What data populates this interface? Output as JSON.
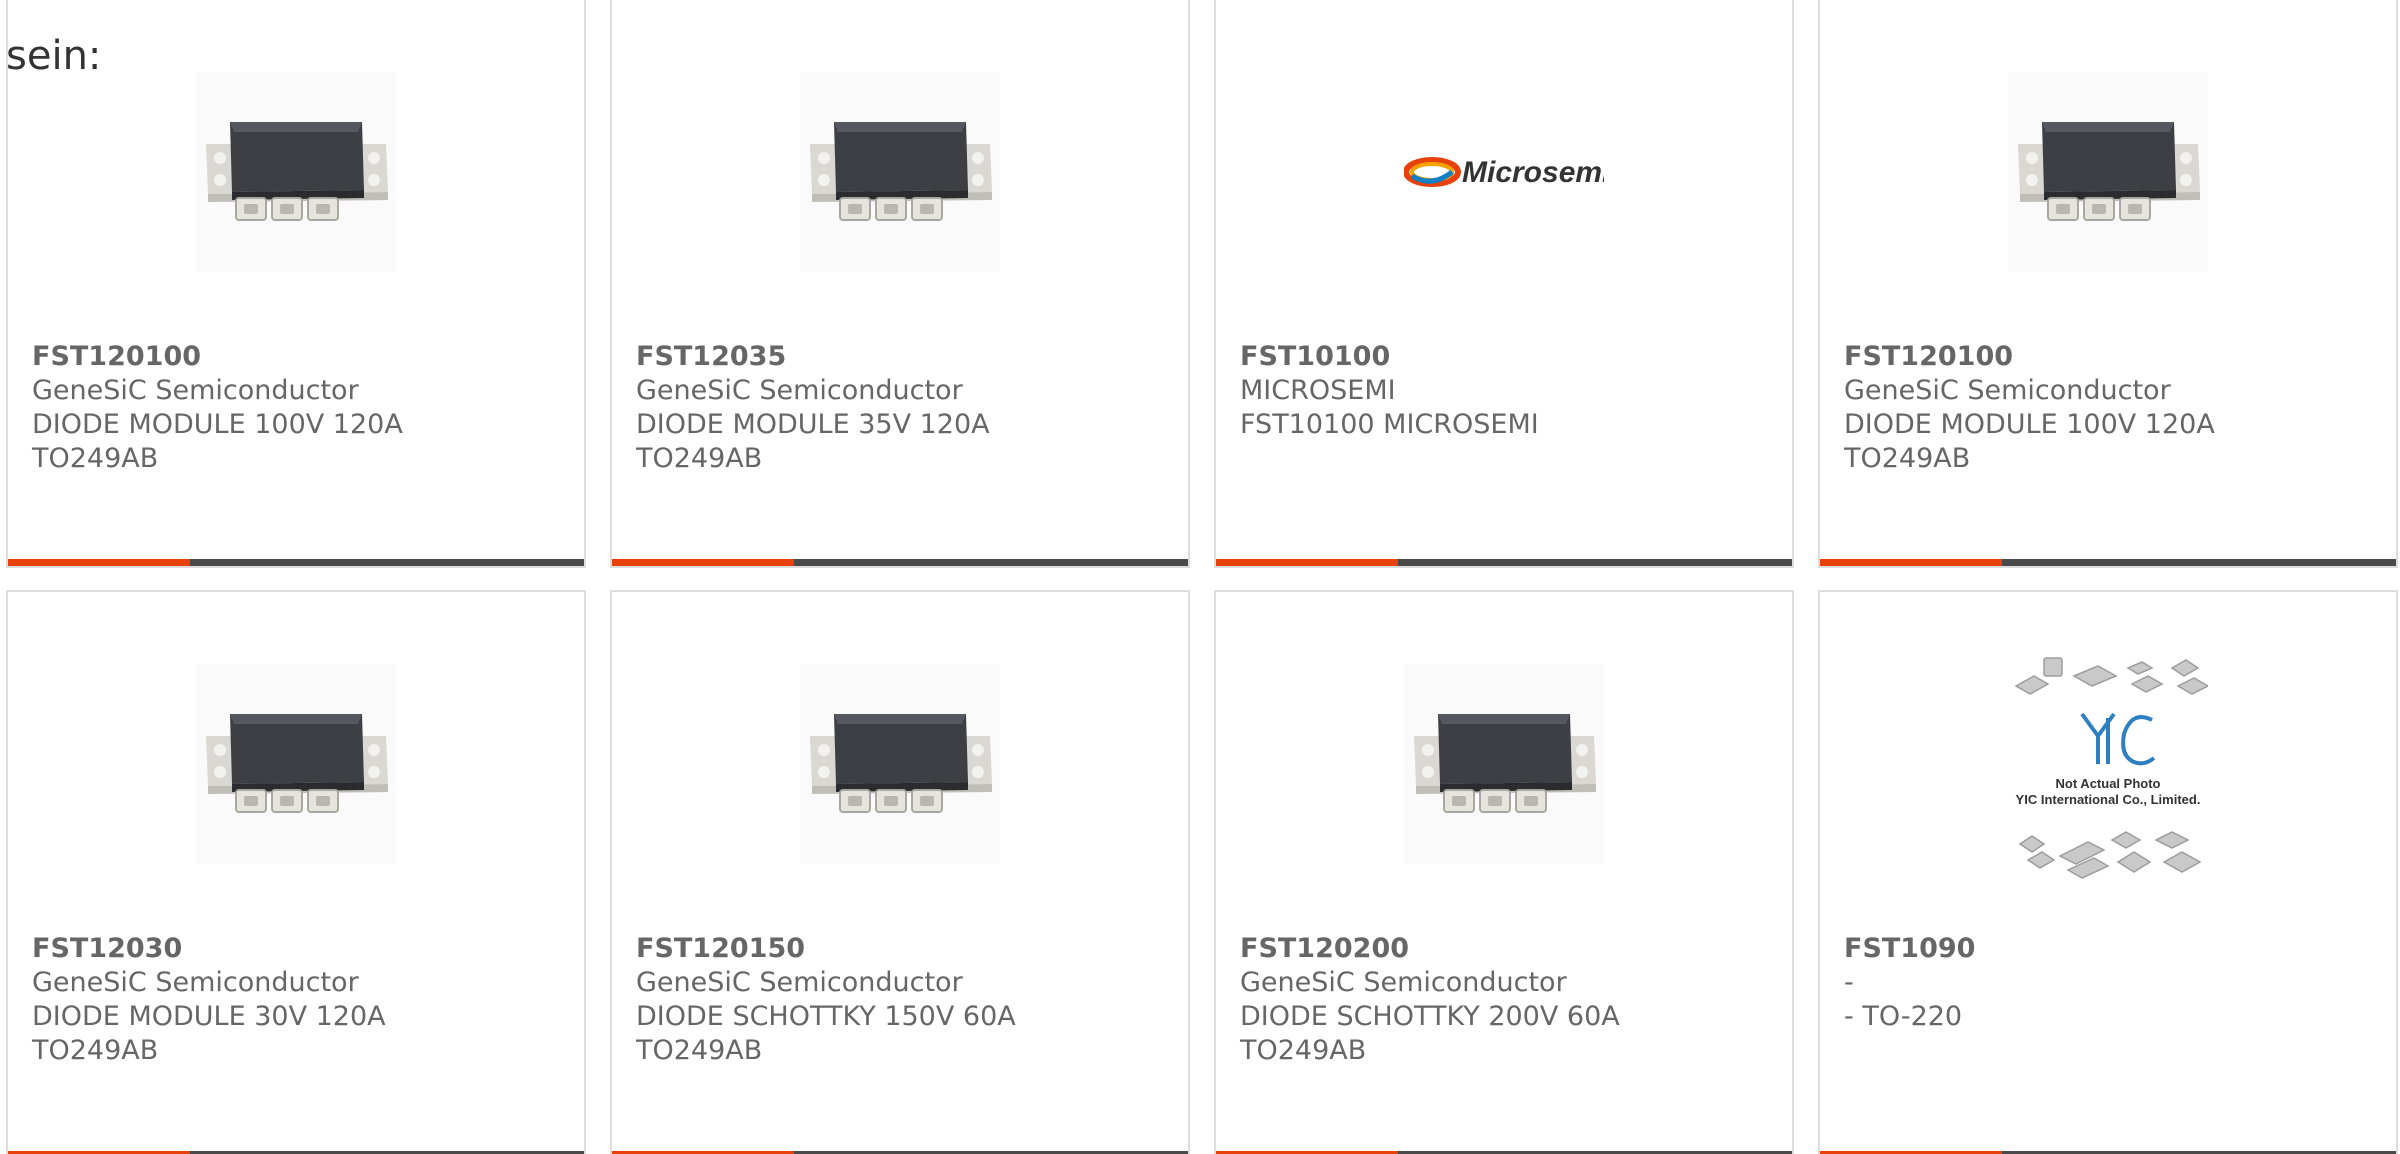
{
  "lead_text": "sein:",
  "colors": {
    "accent_bar": "#e8410c",
    "bar": "#4a4a4a",
    "text": "#666666",
    "border": "#dddddd"
  },
  "products": [
    {
      "part_number": "FST120100",
      "manufacturer": "GeneSiC Semiconductor",
      "description_1": "DIODE MODULE 100V 120A",
      "description_2": "TO249AB",
      "image": "diode-module-image"
    },
    {
      "part_number": "FST12035",
      "manufacturer": "GeneSiC Semiconductor",
      "description_1": "DIODE MODULE 35V 120A",
      "description_2": "TO249AB",
      "image": "diode-module-image"
    },
    {
      "part_number": "FST10100",
      "manufacturer": "MICROSEMI",
      "description_1": "FST10100 MICROSEMI",
      "description_2": "",
      "image": "microsemi-logo",
      "logo_text": "Microsemi"
    },
    {
      "part_number": "FST120100",
      "manufacturer": "GeneSiC Semiconductor",
      "description_1": "DIODE MODULE 100V 120A",
      "description_2": "TO249AB",
      "image": "diode-module-image"
    },
    {
      "part_number": "FST12030",
      "manufacturer": "GeneSiC Semiconductor",
      "description_1": "DIODE MODULE 30V 120A",
      "description_2": "TO249AB",
      "image": "diode-module-image"
    },
    {
      "part_number": "FST120150",
      "manufacturer": "GeneSiC Semiconductor",
      "description_1": "DIODE SCHOTTKY 150V 60A",
      "description_2": "TO249AB",
      "image": "diode-module-image"
    },
    {
      "part_number": "FST120200",
      "manufacturer": "GeneSiC Semiconductor",
      "description_1": "DIODE SCHOTTKY 200V 60A",
      "description_2": "TO249AB",
      "image": "diode-module-image"
    },
    {
      "part_number": "FST1090",
      "manufacturer": "-",
      "description_1": "- TO-220",
      "description_2": "",
      "image": "placeholder-chips-image",
      "placeholder_line_1": "Not Actual Photo",
      "placeholder_line_2": "YIC International Co., Limited."
    }
  ]
}
